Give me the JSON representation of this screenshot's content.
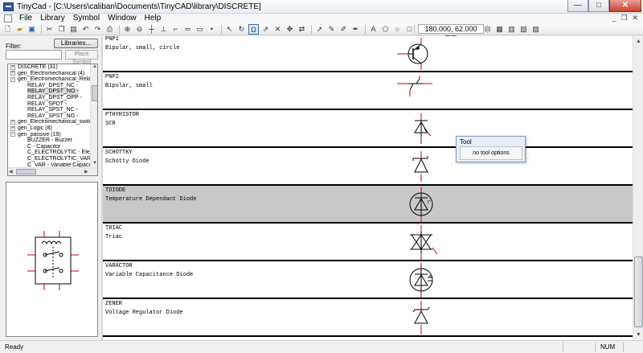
{
  "window": {
    "title": "TinyCad - [C:\\Users\\caliban\\Documents\\TinyCAD\\library\\DISCRETE]",
    "minimize_glyph": "—",
    "maximize_glyph": "□",
    "close_glyph": "✕"
  },
  "menu": {
    "items": [
      "File",
      "Library",
      "Symbol",
      "Window",
      "Help"
    ],
    "mdi_minimize": "_",
    "mdi_restore": "❐",
    "mdi_close": "✕"
  },
  "toolbar": {
    "coordinates": "180.000,  62.000 mm"
  },
  "library_panel": {
    "filter_label": "Filter:",
    "filter_value": "",
    "libraries_button": "Libraries...",
    "place_symbol_button": "Place Symbol",
    "tree": [
      {
        "label": "DISCRETE (31)",
        "level": 0,
        "expander": "+",
        "selected": false
      },
      {
        "label": "gen_Electromechanical (4)",
        "level": 0,
        "expander": "+",
        "selected": false
      },
      {
        "label": "gen_Electromechanical_Relays (",
        "level": 0,
        "expander": "−",
        "selected": false
      },
      {
        "label": "RELAY_DPST_NC -",
        "level": 1,
        "expander": "",
        "selected": false
      },
      {
        "label": "RELAY_DPST_NO -",
        "level": 1,
        "expander": "",
        "selected": true
      },
      {
        "label": "RELAY_DPST_OPP -",
        "level": 1,
        "expander": "",
        "selected": false
      },
      {
        "label": "RELAY_SPDT -",
        "level": 1,
        "expander": "",
        "selected": false
      },
      {
        "label": "RELAY_SPST_NC -",
        "level": 1,
        "expander": "",
        "selected": false
      },
      {
        "label": "RELAY_SPST_NO -",
        "level": 1,
        "expander": "",
        "selected": false
      },
      {
        "label": "gen_Electromechanical_switche:",
        "level": 0,
        "expander": "+",
        "selected": false
      },
      {
        "label": "gen_Logic (8)",
        "level": 0,
        "expander": "+",
        "selected": false
      },
      {
        "label": "gen_passive (19)",
        "level": 0,
        "expander": "−",
        "selected": false
      },
      {
        "label": "BUZZER - Buzzer",
        "level": 1,
        "expander": "",
        "selected": false
      },
      {
        "label": "C - Capacitor",
        "level": 1,
        "expander": "",
        "selected": false
      },
      {
        "label": "C_ELECTROLYTIC - Electrol",
        "level": 1,
        "expander": "",
        "selected": false
      },
      {
        "label": "C_ELECTROLYTIC_VAR - Va",
        "level": 1,
        "expander": "",
        "selected": false
      },
      {
        "label": "C_VAR - Variable Capacitor",
        "level": 1,
        "expander": "",
        "selected": false
      }
    ]
  },
  "symbols": [
    {
      "name": "PNP1",
      "description": "Bipolar, small, circle",
      "glyph": "pnp-circle",
      "selected": false
    },
    {
      "name": "PNP2",
      "description": "Bipolar, small",
      "glyph": "pnp-small",
      "selected": false
    },
    {
      "name": "PTHYRISTOR",
      "description": "SCR",
      "glyph": "scr",
      "selected": false
    },
    {
      "name": "SCHOTTKY",
      "description": "Schotty Diode",
      "glyph": "schottky",
      "selected": false
    },
    {
      "name": "TDIODE",
      "description": "Temperature Dependant Diode",
      "glyph": "tdiode",
      "selected": true
    },
    {
      "name": "TRIAC",
      "description": "Triac",
      "glyph": "triac",
      "selected": false
    },
    {
      "name": "VARACTOR",
      "description": "Variable Capacitance Diode",
      "glyph": "varactor",
      "selected": false
    },
    {
      "name": "ZENER",
      "description": "Voltage Regulator Diode",
      "glyph": "zener",
      "selected": false
    }
  ],
  "tool_popup": {
    "title": "Tool",
    "message": "no tool options"
  },
  "status": {
    "left": "Ready",
    "indicator": "NUM"
  },
  "colors": {
    "pin_red": "#cc0000",
    "selection_gray": "#c8c8c8"
  }
}
